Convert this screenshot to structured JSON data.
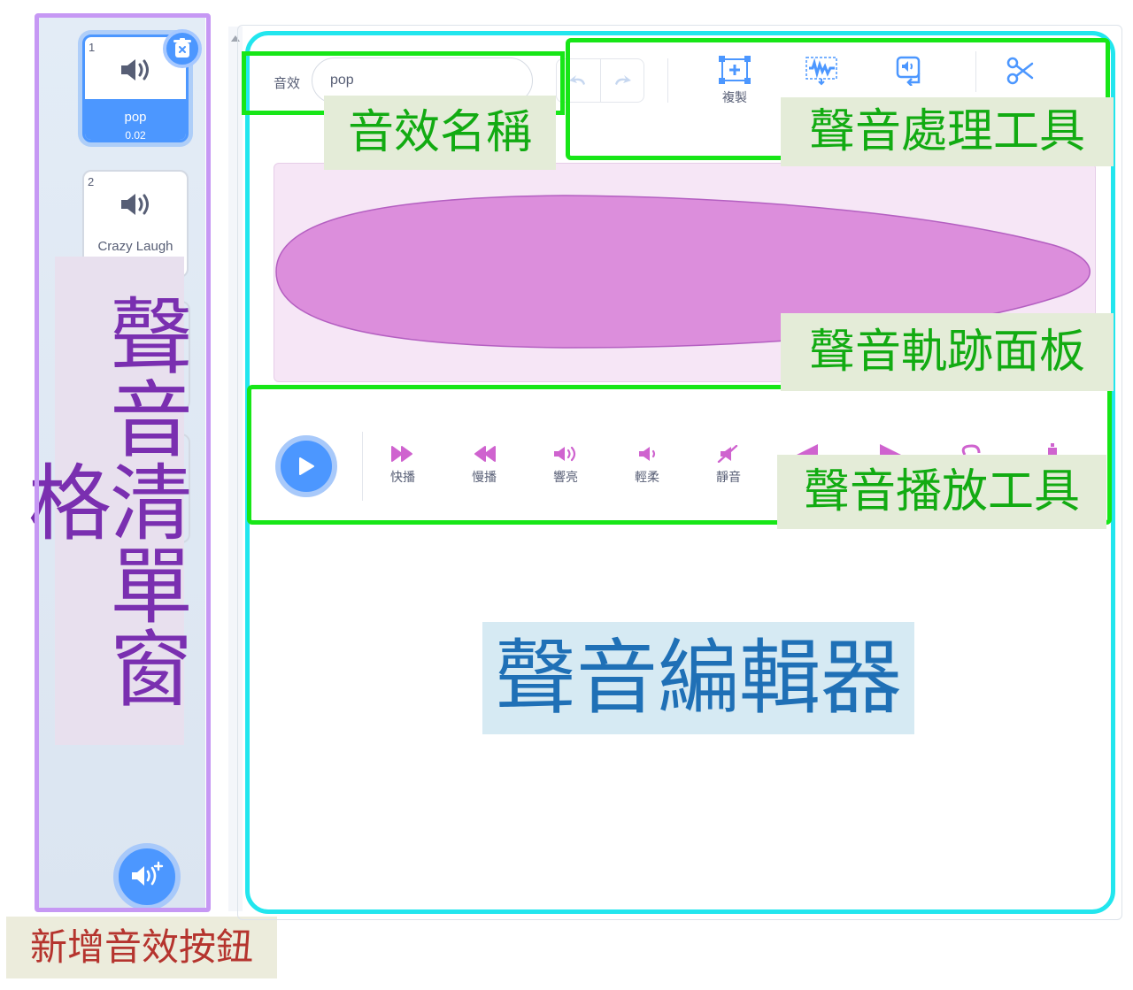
{
  "sound_list": {
    "items": [
      {
        "index": "1",
        "name": "pop",
        "duration": "0.02",
        "selected": true
      },
      {
        "index": "2",
        "name": "Crazy Laugh",
        "selected": false
      }
    ],
    "label": "聲音清單窗格"
  },
  "add_sound": {
    "label": "新增音效按鈕"
  },
  "editor": {
    "sound_label": "音效",
    "sound_name_value": "pop",
    "tools": [
      {
        "label": "複製"
      }
    ],
    "effects": [
      {
        "label": "快播"
      },
      {
        "label": "慢播"
      },
      {
        "label": "響亮"
      },
      {
        "label": "輕柔"
      },
      {
        "label": "靜音"
      }
    ],
    "callouts": {
      "name": "音效名稱",
      "processing_tools": "聲音處理工具",
      "track_panel": "聲音軌跡面板",
      "playback_tools": "聲音播放工具",
      "editor": "聲音編輯器"
    }
  },
  "colors": {
    "accent": "#4c97ff",
    "effect_icon": "#cf63cf",
    "waveform_fill": "#dc8edc",
    "waveform_bg": "#f6e6f6",
    "highlight_green": "#17e617",
    "editor_border": "#22e6ee",
    "list_border": "#c698f4"
  }
}
